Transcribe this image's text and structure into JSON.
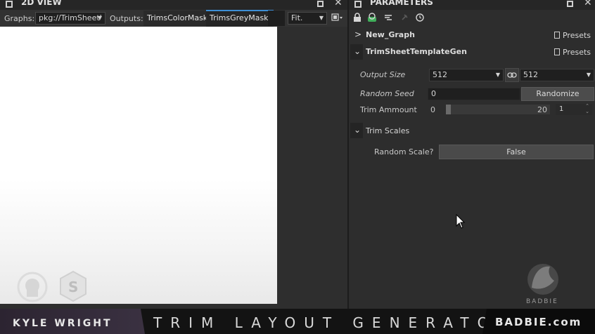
{
  "view2d": {
    "title": "2D VIEW",
    "graphs_label": "Graphs:",
    "graphs_value": "pkg://TrimSheet'",
    "outputs_label": "Outputs:",
    "outputs_tabs": [
      {
        "label": "TrimsColorMask",
        "active": false
      },
      {
        "label": "TrimsGreyMask",
        "active": true
      }
    ],
    "fit_value": "Fit."
  },
  "params": {
    "title": "PARAMETERS",
    "new_graph": {
      "name": "New_Graph",
      "presets": "Presets"
    },
    "trim_gen": {
      "name": "TrimSheetTemplateGen",
      "presets": "Presets"
    },
    "output_size": {
      "label": "Output Size",
      "width": "512",
      "height": "512"
    },
    "random_seed": {
      "label": "Random Seed",
      "value": "0",
      "button": "Randomize"
    },
    "trim_amount": {
      "label": "Trim Ammount",
      "min": "0",
      "max": "20",
      "value": "1",
      "fill_fraction": 0.05
    },
    "trim_scales": {
      "name": "Trim Scales",
      "random_scale_label": "Random Scale?",
      "random_scale_value": "False"
    }
  },
  "banner": {
    "author": "KYLE WRIGHT",
    "title": "TRIM LAYOUT GENERATOR",
    "brand": "BADBIE.com",
    "logo_text": "BADBIE"
  },
  "icons": [
    "window-icon",
    "close-icon",
    "lock-icon",
    "view-icon",
    "pin-icon",
    "reset-icon",
    "link-icon",
    "chevron-icon",
    "doc-icon"
  ]
}
